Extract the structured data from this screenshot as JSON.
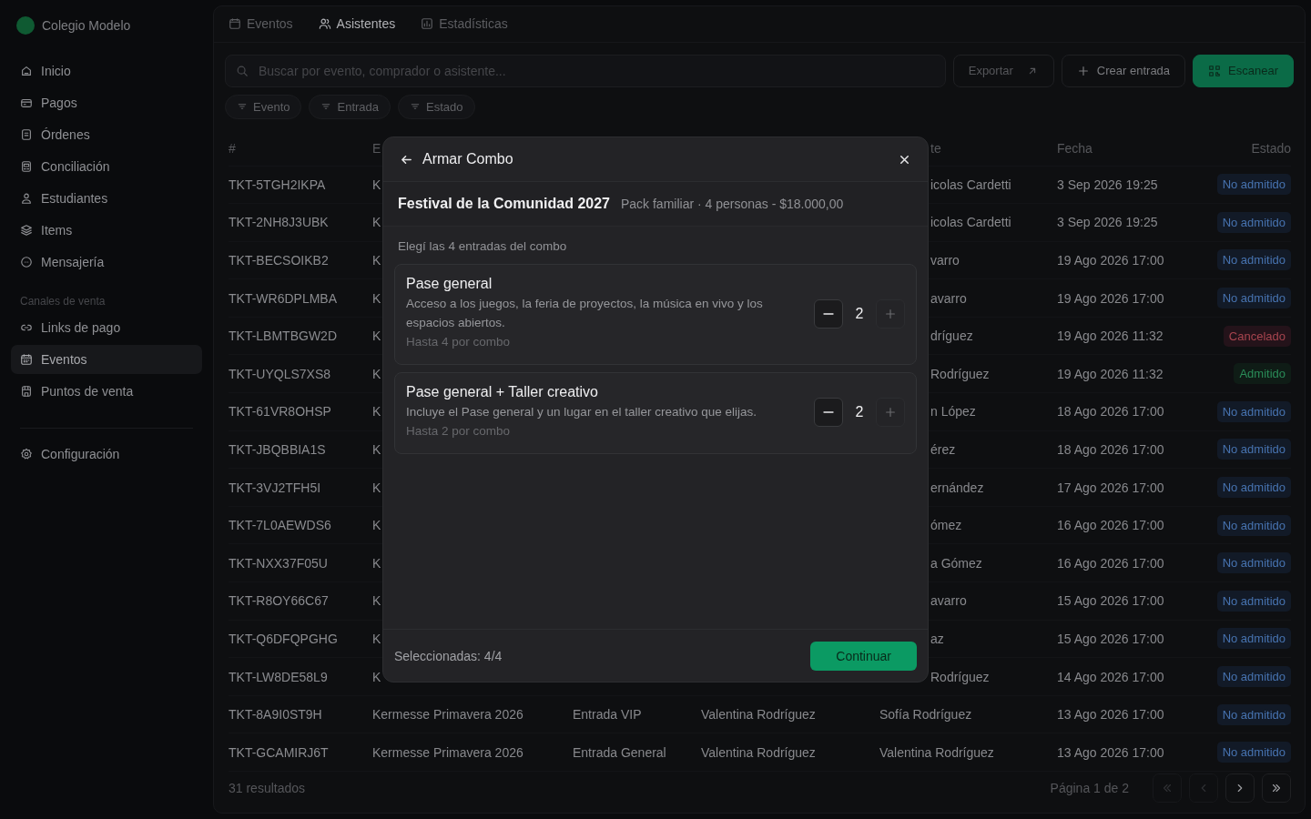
{
  "sidebar": {
    "brand": "Colegio Modelo",
    "items": [
      {
        "label": "Inicio",
        "selected": false
      },
      {
        "label": "Pagos",
        "selected": false
      },
      {
        "label": "Órdenes",
        "selected": false
      },
      {
        "label": "Conciliación",
        "selected": false
      },
      {
        "label": "Estudiantes",
        "selected": false
      },
      {
        "label": "Items",
        "selected": false
      },
      {
        "label": "Mensajería",
        "selected": false
      }
    ],
    "section": "Canales de venta",
    "channel_items": [
      {
        "label": "Links de pago",
        "selected": false
      },
      {
        "label": "Eventos",
        "selected": true
      },
      {
        "label": "Puntos de venta",
        "selected": false
      }
    ],
    "footer_items": [
      {
        "label": "Configuración",
        "selected": false
      }
    ]
  },
  "tabs": [
    {
      "label": "Eventos",
      "selected": false
    },
    {
      "label": "Asistentes",
      "selected": true
    },
    {
      "label": "Estadísticas",
      "selected": false
    }
  ],
  "search": {
    "placeholder": "Buscar por evento, comprador o asistente..."
  },
  "actions": [
    {
      "label": "Exportar",
      "kind": "export"
    },
    {
      "label": "Crear entrada",
      "kind": "create"
    },
    {
      "label": "Escanear",
      "kind": "scan"
    }
  ],
  "filters": [
    "Evento",
    "Entrada",
    "Estado"
  ],
  "table": {
    "columns": {
      "id": "#",
      "event": "E",
      "attendee": "te",
      "date": "Fecha",
      "status": "Estado"
    },
    "rows": [
      {
        "id": "TKT-5TGH2IKPA",
        "event": "K",
        "attendee": "icolas Cardetti",
        "date": "3 Sep 2026 19:25",
        "status": {
          "label": "No admitido",
          "kind": "pending"
        }
      },
      {
        "id": "TKT-2NH8J3UBK",
        "event": "K",
        "attendee": "icolas Cardetti",
        "date": "3 Sep 2026 19:25",
        "status": {
          "label": "No admitido",
          "kind": "pending"
        }
      },
      {
        "id": "TKT-BECSOIKB2",
        "event": "K",
        "attendee": "varro",
        "date": "19 Ago 2026 17:00",
        "status": {
          "label": "No admitido",
          "kind": "pending"
        }
      },
      {
        "id": "TKT-WR6DPLMBA",
        "event": "K",
        "attendee": "avarro",
        "date": "19 Ago 2026 17:00",
        "status": {
          "label": "No admitido",
          "kind": "pending"
        }
      },
      {
        "id": "TKT-LBMTBGW2D",
        "event": "K",
        "attendee": "dríguez",
        "date": "19 Ago 2026 11:32",
        "status": {
          "label": "Cancelado",
          "kind": "cancelled"
        }
      },
      {
        "id": "TKT-UYQLS7XS8",
        "event": "K",
        "attendee": "Rodríguez",
        "date": "19 Ago 2026 11:32",
        "status": {
          "label": "Admitido",
          "kind": "admitted"
        }
      },
      {
        "id": "TKT-61VR8OHSP",
        "event": "K",
        "attendee": "n López",
        "date": "18 Ago 2026 17:00",
        "status": {
          "label": "No admitido",
          "kind": "pending"
        }
      },
      {
        "id": "TKT-JBQBBIA1S",
        "event": "K",
        "attendee": "érez",
        "date": "18 Ago 2026 17:00",
        "status": {
          "label": "No admitido",
          "kind": "pending"
        }
      },
      {
        "id": "TKT-3VJ2TFH5I",
        "event": "K",
        "attendee": "ernández",
        "date": "17 Ago 2026 17:00",
        "status": {
          "label": "No admitido",
          "kind": "pending"
        }
      },
      {
        "id": "TKT-7L0AEWDS6",
        "event": "K",
        "attendee": "ómez",
        "date": "16 Ago 2026 17:00",
        "status": {
          "label": "No admitido",
          "kind": "pending"
        }
      },
      {
        "id": "TKT-NXX37F05U",
        "event": "K",
        "attendee": "a Gómez",
        "date": "16 Ago 2026 17:00",
        "status": {
          "label": "No admitido",
          "kind": "pending"
        }
      },
      {
        "id": "TKT-R8OY66C67",
        "event": "K",
        "attendee": "avarro",
        "date": "15 Ago 2026 17:00",
        "status": {
          "label": "No admitido",
          "kind": "pending"
        }
      },
      {
        "id": "TKT-Q6DFQPGHG",
        "event": "K",
        "attendee": "az",
        "date": "15 Ago 2026 17:00",
        "status": {
          "label": "No admitido",
          "kind": "pending"
        }
      },
      {
        "id": "TKT-LW8DE58L9",
        "event": "K",
        "attendee": "Rodríguez",
        "date": "14 Ago 2026 17:00",
        "status": {
          "label": "No admitido",
          "kind": "pending"
        }
      },
      {
        "id": "TKT-8A9I0ST9H",
        "event": "Kermesse Primavera 2026",
        "ticket": "Entrada VIP",
        "buyer": "Valentina Rodríguez",
        "attendee": "Sofía Rodríguez",
        "date": "13 Ago 2026 17:00",
        "status": {
          "label": "No admitido",
          "kind": "pending"
        }
      },
      {
        "id": "TKT-GCAMIRJ6T",
        "event": "Kermesse Primavera 2026",
        "ticket": "Entrada General",
        "buyer": "Valentina Rodríguez",
        "attendee": "Valentina Rodríguez",
        "date": "13 Ago 2026 17:00",
        "status": {
          "label": "No admitido",
          "kind": "pending"
        }
      }
    ]
  },
  "footer": {
    "count": "31 resultados",
    "page": "Página 1 de 2",
    "pager": [
      {
        "kind": "first",
        "disabled": true
      },
      {
        "kind": "prev",
        "disabled": true
      },
      {
        "kind": "next",
        "disabled": false
      },
      {
        "kind": "last",
        "disabled": false
      }
    ]
  },
  "modal": {
    "title": "Armar Combo",
    "event": "Festival de la Comunidad 2027",
    "subtitle": "Pack familiar · 4 personas - $18.000,00",
    "instruction": "Elegí las 4 entradas del combo",
    "options": [
      {
        "name": "Pase general",
        "description": "Acceso a los juegos, la feria de proyectos, la música en vivo y los espacios abiertos.",
        "limit": "Hasta 4 por combo",
        "quantity": "2",
        "minus_disabled": false,
        "plus_disabled": true
      },
      {
        "name": "Pase general + Taller creativo",
        "description": "Incluye el Pase general y un lugar en el taller creativo que elijas.",
        "limit": "Hasta 2 por combo",
        "quantity": "2",
        "minus_disabled": false,
        "plus_disabled": true
      }
    ],
    "selected": "Seleccionadas: 4/4",
    "button": "Continuar"
  }
}
